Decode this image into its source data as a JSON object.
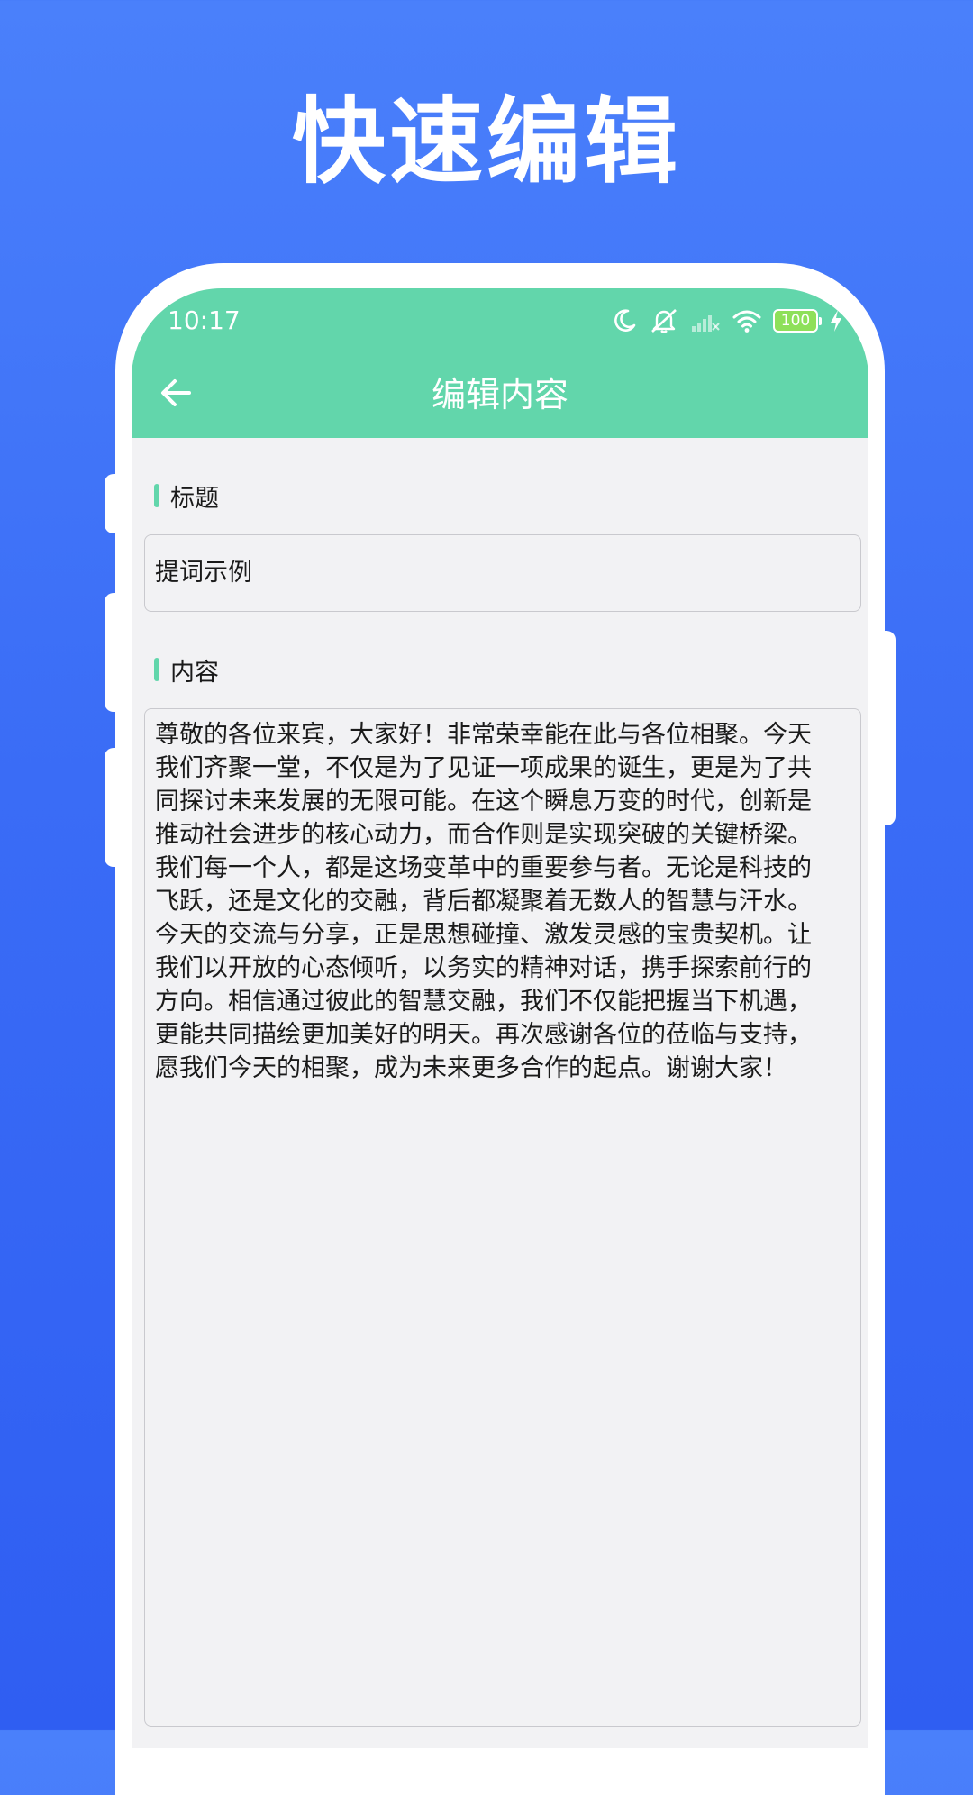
{
  "promo": {
    "title": "快速编辑"
  },
  "status_bar": {
    "time": "10:17",
    "battery": "100",
    "icons": [
      "moon-icon",
      "mute-bell-icon",
      "signal-off-icon",
      "wifi-icon",
      "battery-icon",
      "charging-icon"
    ]
  },
  "appbar": {
    "title": "编辑内容",
    "back_icon": "arrow-left-icon"
  },
  "form": {
    "title_label": "标题",
    "title_value": "提词示例",
    "content_label": "内容",
    "content_value": "尊敬的各位来宾，大家好！非常荣幸能在此与各位相聚。今天\n我们齐聚一堂，不仅是为了见证一项成果的诞生，更是为了共\n同探讨未来发展的无限可能。在这个瞬息万变的时代，创新是\n推动社会进步的核心动力，而合作则是实现突破的关键桥梁。\n我们每一个人，都是这场变革中的重要参与者。无论是科技的\n飞跃，还是文化的交融，背后都凝聚着无数人的智慧与汗水。\n今天的交流与分享，正是思想碰撞、激发灵感的宝贵契机。让\n我们以开放的心态倾听，以务实的精神对话，携手探索前行的\n方向。相信通过彼此的智慧交融，我们不仅能把握当下机遇，\n更能共同描绘更加美好的明天。再次感谢各位的莅临与支持，\n愿我们今天的相聚，成为未来更多合作的起点。谢谢大家！"
  },
  "colors": {
    "background": "#3a6cf6",
    "accent": "#62d6ab",
    "screen": "#f2f2f4"
  }
}
